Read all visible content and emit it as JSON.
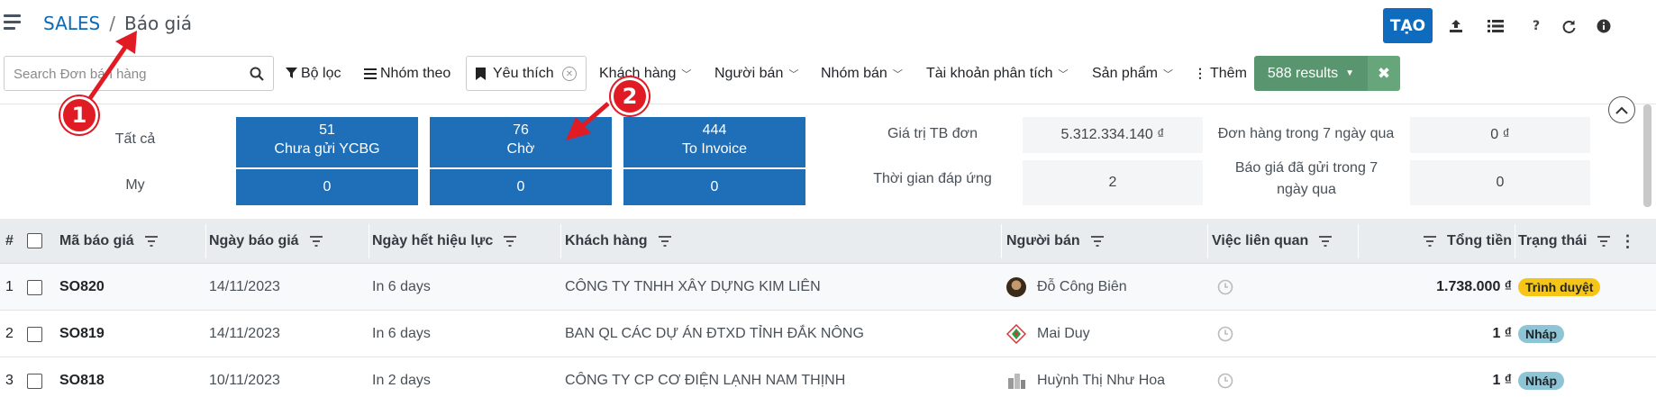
{
  "breadcrumb": {
    "app": "SALES",
    "separator": "/",
    "current": "Báo giá"
  },
  "topbar": {
    "create_label": "TẠO",
    "icons": [
      "upload-icon",
      "list-view-icon",
      "help-icon",
      "refresh-icon",
      "info-icon"
    ],
    "help_glyph": "?"
  },
  "search": {
    "placeholder": "Search Đơn bán hàng"
  },
  "filters": {
    "filter_label": "Bộ lọc",
    "groupby_label": "Nhóm theo",
    "favorite_label": "Yêu thích",
    "dropdowns": [
      "Khách hàng",
      "Người bán",
      "Nhóm bán",
      "Tài khoản phân tích",
      "Sản phẩm"
    ],
    "more_label": "Thêm",
    "results_label": "588 results"
  },
  "dashboard": {
    "row_labels": {
      "all": "Tất cả",
      "my": "My"
    },
    "tiles_all": [
      {
        "value": "51",
        "label": "Chưa gửi YCBG"
      },
      {
        "value": "76",
        "label": "Chờ"
      },
      {
        "value": "444",
        "label": "To Invoice"
      }
    ],
    "tiles_my": [
      "0",
      "0",
      "0"
    ],
    "stats": [
      {
        "label": "Giá trị TB đơn",
        "value": "5.312.334.140 ₫"
      },
      {
        "label": "Đơn hàng trong 7 ngày qua",
        "value": "0 ₫"
      },
      {
        "label": "Thời gian đáp ứng",
        "value": "2"
      },
      {
        "label": "Báo giá đã gửi trong 7 ngày qua",
        "value": "0"
      }
    ]
  },
  "table": {
    "headers": {
      "num": "#",
      "code": "Mã báo giá",
      "date": "Ngày báo giá",
      "expiry": "Ngày hết hiệu lực",
      "customer": "Khách hàng",
      "salesperson": "Người bán",
      "activity": "Việc liên quan",
      "total": "Tổng tiền",
      "status": "Trạng thái"
    },
    "rows": [
      {
        "num": "1",
        "code": "SO820",
        "date": "14/11/2023",
        "expiry": "In 6 days",
        "customer": "CÔNG TY TNHH XÂY DỰNG KIM LIÊN",
        "salesperson": "Đỗ Công Biên",
        "total": "1.738.000 ₫",
        "status": "Trình duyệt"
      },
      {
        "num": "2",
        "code": "SO819",
        "date": "14/11/2023",
        "expiry": "In 6 days",
        "customer": "BAN QL CÁC DỰ ÁN ĐTXD TỈNH ĐẮK NÔNG",
        "salesperson": "Mai Duy",
        "total": "1 ₫",
        "status": "Nháp"
      },
      {
        "num": "3",
        "code": "SO818",
        "date": "10/11/2023",
        "expiry": "In 2 days",
        "customer": "CÔNG TY CP CƠ ĐIỆN LẠNH NAM THỊNH",
        "salesperson": "Huỳnh Thị Như Hoa",
        "total": "1 ₫",
        "status": "Nháp"
      }
    ]
  },
  "annotations": {
    "marker1": "1",
    "marker2": "2"
  },
  "colors": {
    "primary": "#0f6bbd",
    "tile": "#1f6fb8",
    "results": "#59956e",
    "badge_review": "#f5c518",
    "badge_draft": "#8ec5d6",
    "marker": "#e01b24"
  }
}
